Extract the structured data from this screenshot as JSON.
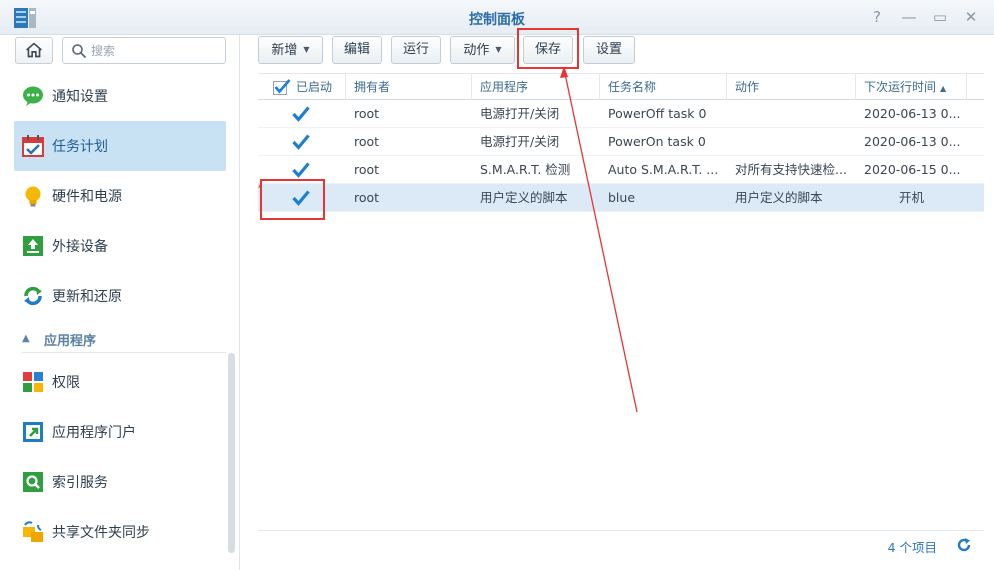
{
  "window": {
    "title": "控制面板",
    "help": "?",
    "minimize": "—",
    "maximize": "▭",
    "close": "✕"
  },
  "sidebar": {
    "search_placeholder": "搜索",
    "items": [
      {
        "label": "通知设置",
        "icon": "chat-bubble-icon"
      },
      {
        "label": "任务计划",
        "icon": "calendar-check-icon",
        "active": true
      },
      {
        "label": "硬件和电源",
        "icon": "lightbulb-icon"
      },
      {
        "label": "外接设备",
        "icon": "external-device-icon"
      },
      {
        "label": "更新和还原",
        "icon": "refresh-icon"
      }
    ],
    "section": "应用程序",
    "app_items": [
      {
        "label": "权限",
        "icon": "privileges-icon"
      },
      {
        "label": "应用程序门户",
        "icon": "app-portal-icon"
      },
      {
        "label": "索引服务",
        "icon": "index-search-icon"
      },
      {
        "label": "共享文件夹同步",
        "icon": "folder-sync-icon"
      }
    ]
  },
  "toolbar": {
    "create": "新增",
    "edit": "编辑",
    "run": "运行",
    "action": "动作",
    "save": "保存",
    "settings": "设置"
  },
  "grid": {
    "columns": [
      "已启动",
      "拥有者",
      "应用程序",
      "任务名称",
      "动作",
      "下次运行时间"
    ],
    "rows": [
      {
        "enabled": true,
        "owner": "root",
        "app": "电源打开/关闭",
        "task": "PowerOff task 0",
        "action": "",
        "next_run": "2020-06-13 0..."
      },
      {
        "enabled": true,
        "owner": "root",
        "app": "电源打开/关闭",
        "task": "PowerOn task 0",
        "action": "",
        "next_run": "2020-06-13 0..."
      },
      {
        "enabled": true,
        "owner": "root",
        "app": "S.M.A.R.T. 检测",
        "task": "Auto S.M.A.R.T. ...",
        "action": "对所有支持快速检...",
        "next_run": "2020-06-15 0..."
      },
      {
        "enabled": true,
        "owner": "root",
        "app": "用户定义的脚本",
        "task": "blue",
        "action": "用户定义的脚本",
        "next_run": "开机",
        "selected": true
      }
    ],
    "item_count": "4 个项目"
  },
  "colors": {
    "accent": "#2f78b8",
    "annotation": "#e53535",
    "selected_row": "#dbeaf6"
  }
}
